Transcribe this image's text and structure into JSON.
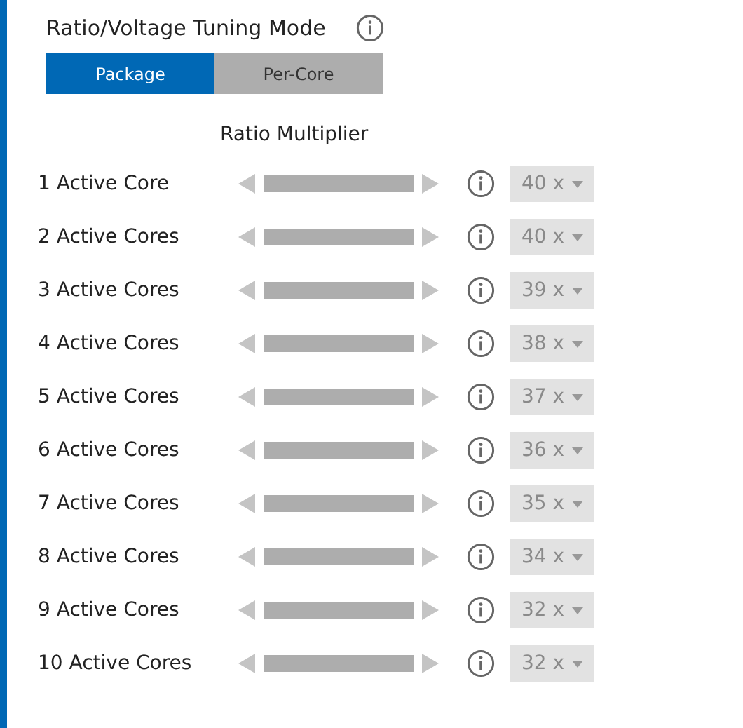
{
  "mode": {
    "title": "Ratio/Voltage Tuning Mode",
    "tabs": [
      {
        "label": "Package",
        "selected": true
      },
      {
        "label": "Per-Core",
        "selected": false
      }
    ]
  },
  "column_header": "Ratio Multiplier",
  "rows": [
    {
      "label": "1 Active Core",
      "value": "40 x",
      "disabled": true
    },
    {
      "label": "2 Active Cores",
      "value": "40 x",
      "disabled": true
    },
    {
      "label": "3 Active Cores",
      "value": "39 x",
      "disabled": true
    },
    {
      "label": "4 Active Cores",
      "value": "38 x",
      "disabled": true
    },
    {
      "label": "5 Active Cores",
      "value": "37 x",
      "disabled": true
    },
    {
      "label": "6 Active Cores",
      "value": "36 x",
      "disabled": true
    },
    {
      "label": "7 Active Cores",
      "value": "35 x",
      "disabled": true
    },
    {
      "label": "8 Active Cores",
      "value": "34 x",
      "disabled": true
    },
    {
      "label": "9 Active Cores",
      "value": "32 x",
      "disabled": true
    },
    {
      "label": "10 Active Cores",
      "value": "32 x",
      "disabled": true
    }
  ]
}
